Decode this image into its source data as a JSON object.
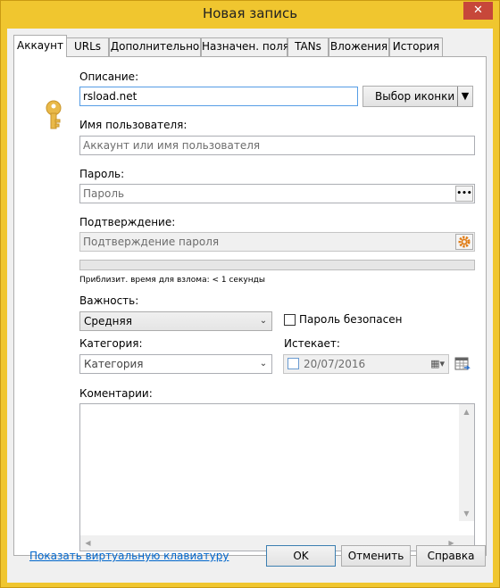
{
  "window": {
    "title": "Новая запись",
    "close_glyph": "✕"
  },
  "tabs": [
    {
      "label": "Аккаунт"
    },
    {
      "label": "URLs"
    },
    {
      "label": "Дополнительно"
    },
    {
      "label": "Назначен. поля"
    },
    {
      "label": "TANs"
    },
    {
      "label": "Вложения"
    },
    {
      "label": "История"
    }
  ],
  "account": {
    "icon": "key-icon",
    "description_label": "Описание:",
    "description_value": "rsload.net",
    "icon_picker_label": "Выбор иконки",
    "username_label": "Имя пользователя:",
    "username_placeholder": "Аккаунт или имя пользователя",
    "password_label": "Пароль:",
    "password_placeholder": "Пароль",
    "password_toggle": "•••",
    "confirm_label": "Подтверждение:",
    "confirm_placeholder": "Подтверждение пароля",
    "crack_time": "Приблизит. время для взлома: < 1 секунды",
    "importance_label": "Важность:",
    "importance_value": "Средняя",
    "safe_password_label": "Пароль безопасен",
    "category_label": "Категория:",
    "category_value": "Категория",
    "expires_label": "Истекает:",
    "expires_value": "20/07/2016",
    "comments_label": "Коментарии:"
  },
  "footer": {
    "virtual_keyboard_link": "Показать виртуальную клавиатуру",
    "ok_label": "OK",
    "cancel_label": "Отменить",
    "help_label": "Справка"
  },
  "colors": {
    "window_frame": "#f0c62f",
    "close_button": "#c7473a",
    "link": "#0066cc"
  }
}
